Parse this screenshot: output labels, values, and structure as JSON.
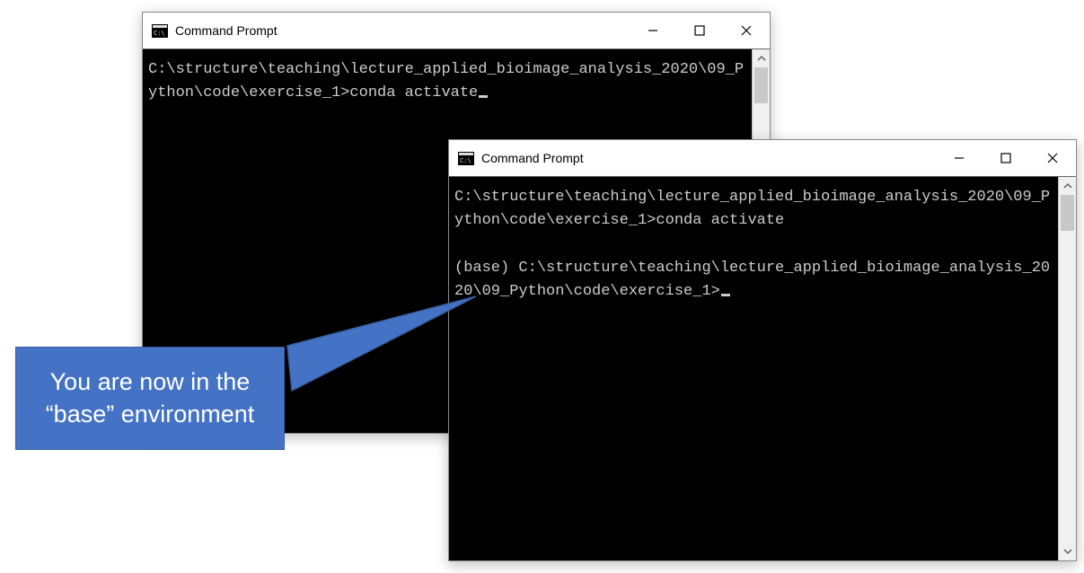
{
  "window1": {
    "title": "Command Prompt",
    "terminal": {
      "line1": "C:\\structure\\teaching\\lecture_applied_bioimage_analysis_2020\\09_Python\\code\\exercise_1>conda activate"
    }
  },
  "window2": {
    "title": "Command Prompt",
    "terminal": {
      "line1": "C:\\structure\\teaching\\lecture_applied_bioimage_analysis_2020\\09_Python\\code\\exercise_1>conda activate",
      "blank": " ",
      "line2": "(base) C:\\structure\\teaching\\lecture_applied_bioimage_analysis_2020\\09_Python\\code\\exercise_1>"
    }
  },
  "callout": {
    "text": "You are now in the “base” environment"
  }
}
